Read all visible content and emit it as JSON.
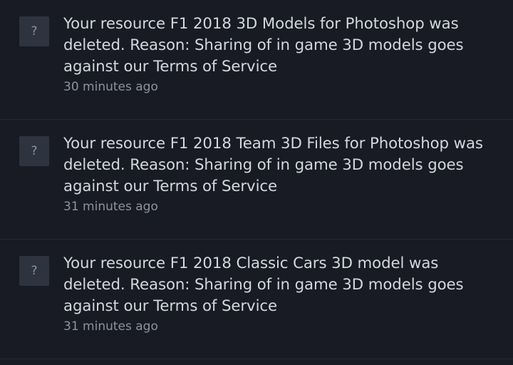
{
  "notifications": [
    {
      "avatar_glyph": "?",
      "message": "Your resource F1 2018 3D Models for Photoshop was deleted. Reason: Sharing of in game 3D models goes against our Terms of Service",
      "time": "30 minutes ago"
    },
    {
      "avatar_glyph": "?",
      "message": "Your resource F1 2018 Team 3D Files for Photoshop was deleted. Reason: Sharing of in game 3D models goes against our Terms of Service",
      "time": "31 minutes ago"
    },
    {
      "avatar_glyph": "?",
      "message": "Your resource F1 2018 Classic Cars 3D model was deleted. Reason: Sharing of in game 3D models goes against our Terms of Service",
      "time": "31 minutes ago"
    }
  ]
}
